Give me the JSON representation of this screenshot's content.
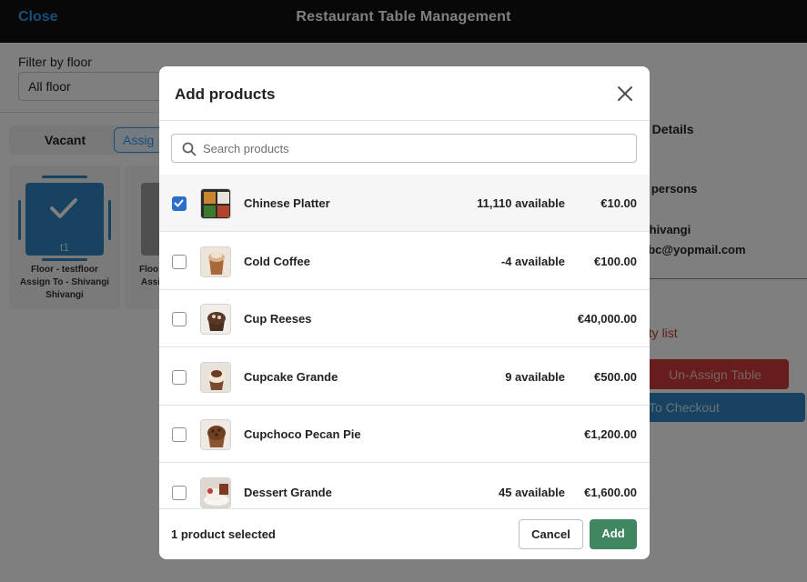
{
  "app": {
    "close_label": "Close",
    "title": "Restaurant Table Management"
  },
  "background": {
    "filter_label": "Filter by floor",
    "filter_value": "All floor",
    "tabs": [
      "Vacant",
      "Assig"
    ],
    "tables": [
      {
        "name": "t1",
        "line1": "Floor - testfloor",
        "line2": "Assign To - Shivangi",
        "line3": "Shivangi"
      },
      {
        "line1": "Floo",
        "line2": "Assi"
      }
    ],
    "details": {
      "title": "e Details",
      "persons": "3 persons",
      "name": "Shivangi",
      "email": "abc@yopmail.com",
      "empty_text": "pty list",
      "unassign_label": "Un-Assign Table",
      "checkout_label": "To Checkout"
    }
  },
  "modal": {
    "title": "Add products",
    "close_icon": "close-icon",
    "search": {
      "placeholder": "Search products",
      "value": "",
      "icon": "search-icon"
    },
    "products": [
      {
        "name": "Chinese Platter",
        "available": "11,110 available",
        "price": "€10.00",
        "checked": true
      },
      {
        "name": "Cold Coffee",
        "available": "-4 available",
        "price": "€100.00",
        "checked": false
      },
      {
        "name": "Cup Reeses",
        "available": "",
        "price": "€40,000.00",
        "checked": false
      },
      {
        "name": "Cupcake Grande",
        "available": "9 available",
        "price": "€500.00",
        "checked": false
      },
      {
        "name": "Cupchoco Pecan Pie",
        "available": "",
        "price": "€1,200.00",
        "checked": false
      },
      {
        "name": "Dessert Grande",
        "available": "45 available",
        "price": "€1,600.00",
        "checked": false
      }
    ],
    "footer": {
      "selected_count": "1 product selected",
      "cancel_label": "Cancel",
      "add_label": "Add"
    }
  },
  "colors": {
    "accent_blue": "#2f9cf4",
    "checkbox_blue": "#2c6ecb",
    "add_green": "#3f8661",
    "danger_red": "#d13a3a"
  }
}
